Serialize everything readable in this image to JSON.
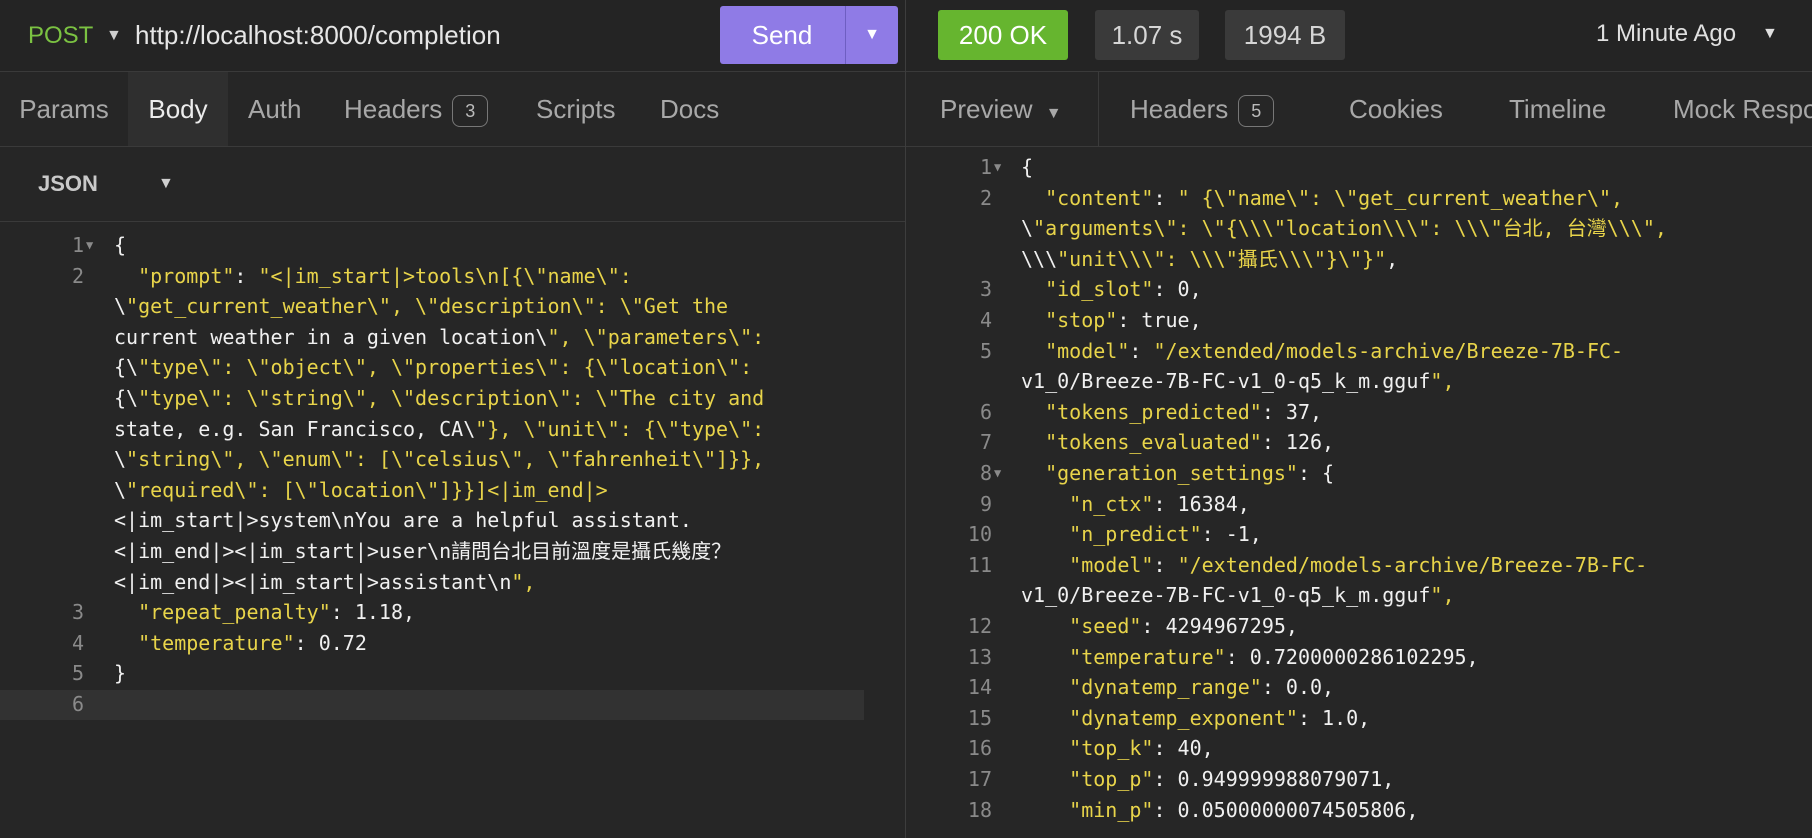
{
  "request": {
    "method": "POST",
    "url": "http://localhost:8000/completion",
    "send_label": "Send",
    "tabs": [
      {
        "label": "Params"
      },
      {
        "label": "Body"
      },
      {
        "label": "Auth"
      },
      {
        "label": "Headers",
        "count": "3"
      },
      {
        "label": "Scripts"
      },
      {
        "label": "Docs"
      }
    ],
    "body_mode": "JSON",
    "body_lines": [
      {
        "n": "1",
        "text": "{"
      },
      {
        "n": "2",
        "text": "  \"prompt\": \"<|im_start|>tools\\n[{\\\"name\\\":"
      },
      {
        "n": "",
        "text": "\\\"get_current_weather\\\", \\\"description\\\": \\\"Get the"
      },
      {
        "n": "",
        "text": "current weather in a given location\\\", \\\"parameters\\\":"
      },
      {
        "n": "",
        "text": "{\\\"type\\\": \\\"object\\\", \\\"properties\\\": {\\\"location\\\":"
      },
      {
        "n": "",
        "text": "{\\\"type\\\": \\\"string\\\", \\\"description\\\": \\\"The city and"
      },
      {
        "n": "",
        "text": "state, e.g. San Francisco, CA\\\"}, \\\"unit\\\": {\\\"type\\\":"
      },
      {
        "n": "",
        "text": "\\\"string\\\", \\\"enum\\\": [\\\"celsius\\\", \\\"fahrenheit\\\"]}},"
      },
      {
        "n": "",
        "text": "\\\"required\\\": [\\\"location\\\"]}}]<|im_end|>"
      },
      {
        "n": "",
        "text": "<|im_start|>system\\nYou are a helpful assistant."
      },
      {
        "n": "",
        "text": "<|im_end|><|im_start|>user\\n請問台北目前溫度是攝氏幾度？"
      },
      {
        "n": "",
        "text": "<|im_end|><|im_start|>assistant\\n\","
      },
      {
        "n": "3",
        "text": "  \"repeat_penalty\": 1.18,"
      },
      {
        "n": "4",
        "text": "  \"temperature\": 0.72"
      },
      {
        "n": "5",
        "text": "}"
      },
      {
        "n": "6",
        "text": ""
      }
    ]
  },
  "response": {
    "status": "200 OK",
    "time": "1.07 s",
    "size": "1994 B",
    "ago": "1 Minute Ago",
    "tabs": [
      {
        "label": "Preview"
      },
      {
        "label": "Headers",
        "count": "5"
      },
      {
        "label": "Cookies"
      },
      {
        "label": "Timeline"
      },
      {
        "label": "Mock Respo"
      }
    ],
    "lines": [
      {
        "n": "1",
        "text": "{"
      },
      {
        "n": "2",
        "text": "  \"content\": \" {\\\"name\\\": \\\"get_current_weather\\\","
      },
      {
        "n": "",
        "text": "\\\"arguments\\\": \\\"{\\\\\\\"location\\\\\\\": \\\\\\\"台北, 台灣\\\\\\\","
      },
      {
        "n": "",
        "text": "\\\\\\\"unit\\\\\\\": \\\\\\\"攝氏\\\\\\\"}\\\"}\","
      },
      {
        "n": "3",
        "text": "  \"id_slot\": 0,"
      },
      {
        "n": "4",
        "text": "  \"stop\": true,"
      },
      {
        "n": "5",
        "text": "  \"model\": \"/extended/models-archive/Breeze-7B-FC-"
      },
      {
        "n": "",
        "text": "v1_0/Breeze-7B-FC-v1_0-q5_k_m.gguf\","
      },
      {
        "n": "6",
        "text": "  \"tokens_predicted\": 37,"
      },
      {
        "n": "7",
        "text": "  \"tokens_evaluated\": 126,"
      },
      {
        "n": "8",
        "text": "  \"generation_settings\": {"
      },
      {
        "n": "9",
        "text": "    \"n_ctx\": 16384,"
      },
      {
        "n": "10",
        "text": "    \"n_predict\": -1,"
      },
      {
        "n": "11",
        "text": "    \"model\": \"/extended/models-archive/Breeze-7B-FC-"
      },
      {
        "n": "",
        "text": "v1_0/Breeze-7B-FC-v1_0-q5_k_m.gguf\","
      },
      {
        "n": "12",
        "text": "    \"seed\": 4294967295,"
      },
      {
        "n": "13",
        "text": "    \"temperature\": 0.7200000286102295,"
      },
      {
        "n": "14",
        "text": "    \"dynatemp_range\": 0.0,"
      },
      {
        "n": "15",
        "text": "    \"dynatemp_exponent\": 1.0,"
      },
      {
        "n": "16",
        "text": "    \"top_k\": 40,"
      },
      {
        "n": "17",
        "text": "    \"top_p\": 0.949999988079071,"
      },
      {
        "n": "18",
        "text": "    \"min_p\": 0.05000000074505806,"
      }
    ]
  },
  "colors": {
    "accent": "#8f7be6",
    "ok": "#66b52f",
    "method": "#7bc242",
    "string": "#e8d44a"
  }
}
